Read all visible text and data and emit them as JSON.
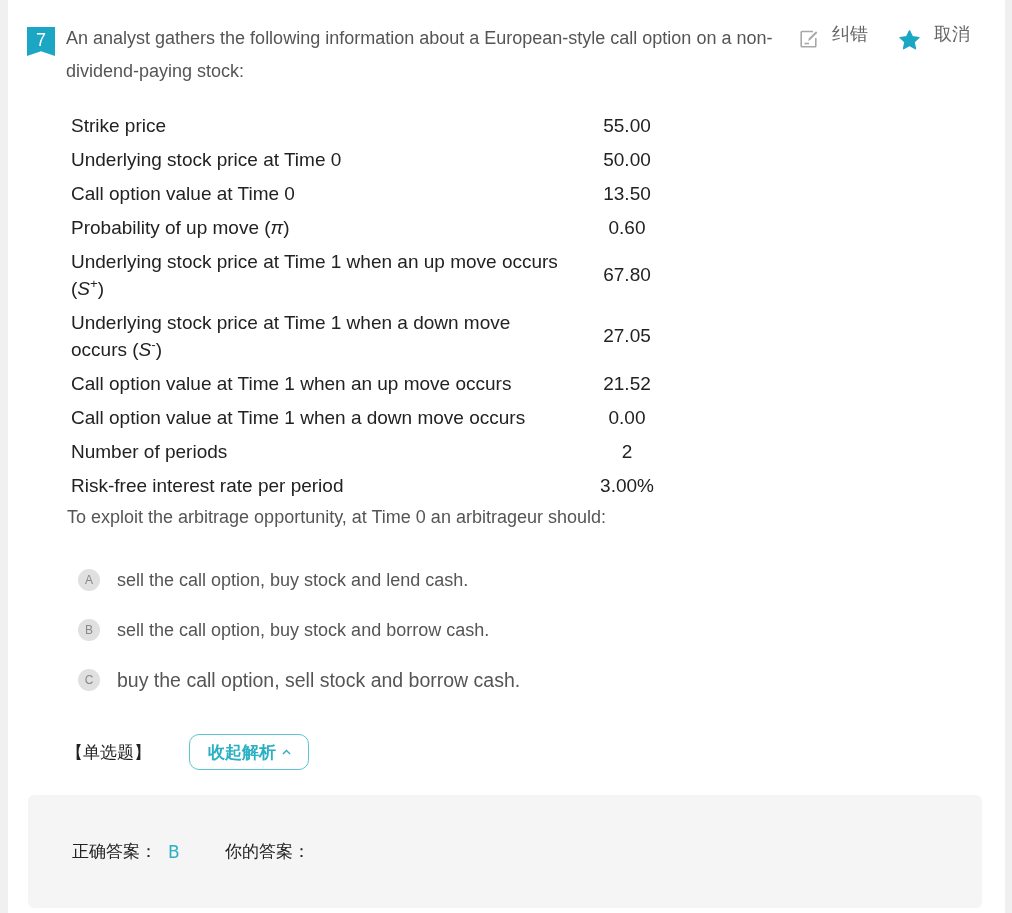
{
  "question": {
    "number": "7",
    "text": "An analyst gathers the following information about a European-style call option on a non-dividend-paying stock:"
  },
  "actions": [
    {
      "kind": "edit",
      "label": "纠错"
    },
    {
      "kind": "favorite",
      "label": "取消",
      "on": true
    }
  ],
  "table": {
    "rows": [
      {
        "label": "Strike price",
        "value": "55.00"
      },
      {
        "label": "Underlying stock price at Time 0",
        "value": "50.00"
      },
      {
        "label": "Call option value at Time 0",
        "value": "13.50"
      },
      {
        "label": "Probability of up move (*π*)",
        "value": "0.60"
      },
      {
        "label": "Underlying stock price at Time 1 when an up move occurs (*S*$^{+}$)",
        "value": "67.80"
      },
      {
        "label": "Underlying stock price at Time 1 when a down move occurs (*S*$^{-}$)",
        "value": "27.05"
      },
      {
        "label": "Call option value at Time 1 when an up move occurs",
        "value": "21.52"
      },
      {
        "label": "Call option value at Time 1 when a down move occurs",
        "value": "0.00"
      },
      {
        "label": "Number of periods",
        "value": "2"
      },
      {
        "label": "Risk-free interest rate per period",
        "value": "3.00%"
      }
    ]
  },
  "prompt": "To exploit the arbitrage opportunity, at Time 0 an arbitrageur should:",
  "options": [
    {
      "letter": "A",
      "text": "sell the call option, buy stock and lend cash.",
      "hovered": false
    },
    {
      "letter": "B",
      "text": "sell the call option, buy stock and borrow cash.",
      "hovered": false
    },
    {
      "letter": "C",
      "text": "buy the call option, sell stock and borrow cash.",
      "hovered": true
    }
  ],
  "question_type": "【单选题】",
  "toggle_button": {
    "label": "收起解析",
    "expanded": true
  },
  "answer_panel": {
    "correct_label": "正确答案：",
    "correct_value": "B",
    "your_label": "你的答案："
  }
}
